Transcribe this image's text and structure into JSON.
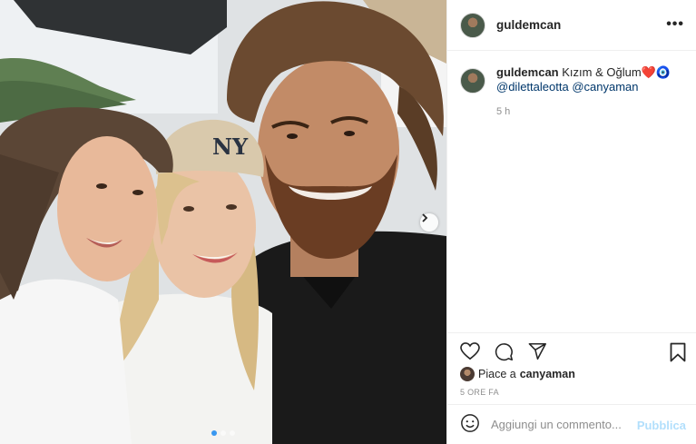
{
  "post": {
    "username": "guldemcan",
    "caption_text": " Kızım & Oğlum",
    "caption_emojis": "❤️🧿",
    "mentions": [
      "@dilettaleotta",
      "@canyaman"
    ],
    "time_ago": "5 h"
  },
  "likes": {
    "prefix": "Piace a",
    "user": "canyaman"
  },
  "timestamp": "5 ORE FA",
  "comment": {
    "placeholder": "Aggiungi un commento...",
    "publish_label": "Pubblica"
  },
  "carousel": {
    "slides": 3,
    "active_index": 0
  },
  "colors": {
    "accent": "#3897f0",
    "publish_disabled": "#b2dffc",
    "muted": "#8e8e8e",
    "mention": "#00376b"
  },
  "icons": [
    "heart-icon",
    "comment-icon",
    "share-icon",
    "bookmark-icon",
    "emoji-icon",
    "more-icon",
    "chevron-right-icon"
  ]
}
